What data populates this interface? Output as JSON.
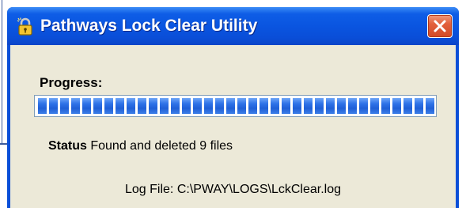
{
  "window": {
    "title": "Pathways Lock Clear Utility",
    "title_icon": "lock-utility-icon",
    "close_icon": "close-icon"
  },
  "progress": {
    "label": "Progress:",
    "fraction": 1.0
  },
  "status": {
    "key": "Status",
    "text": "Found and deleted 9 files"
  },
  "log": {
    "text": "Log File: C:\\PWAY\\LOGS\\LckClear.log"
  },
  "colors": {
    "titlebar": "#0a55e0",
    "close_button": "#d34a26",
    "client_background": "#ece9d8",
    "progress_segment": "#2f73e8"
  }
}
